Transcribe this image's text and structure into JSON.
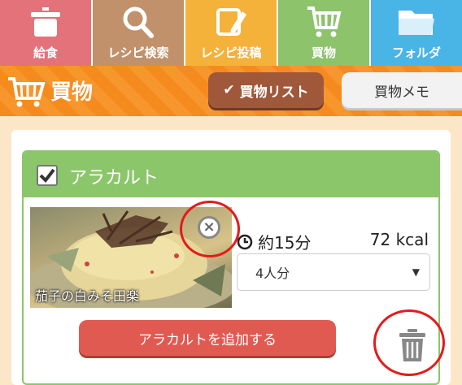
{
  "nav": {
    "tabs": [
      {
        "label": "給食",
        "color": "#e3727a",
        "icon": "pot-icon"
      },
      {
        "label": "レシピ検索",
        "color": "#c0916b",
        "icon": "search-icon"
      },
      {
        "label": "レシピ投稿",
        "color": "#f5b23b",
        "icon": "pencil-icon"
      },
      {
        "label": "買物",
        "color": "#8dc36b",
        "icon": "cart-icon"
      },
      {
        "label": "フォルダ",
        "color": "#49b4e6",
        "icon": "folder-icon"
      }
    ]
  },
  "header": {
    "title": "買物",
    "list_button": "買物リスト",
    "memo_button": "買物メモ"
  },
  "card": {
    "title": "アラカルト",
    "checked": true,
    "recipe_name": "茄子の白みそ田楽",
    "time": "約15分",
    "kcal": "72 kcal",
    "servings": "4人分",
    "add_button": "アラカルトを追加する"
  },
  "colors": {
    "accent_orange": "#f58a1e",
    "green": "#8cc66b",
    "highlight_red": "#e41b1b"
  }
}
